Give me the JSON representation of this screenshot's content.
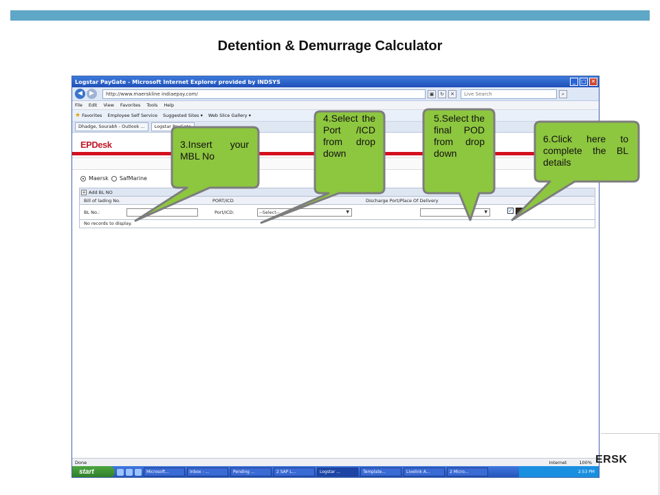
{
  "slide": {
    "title": "Detention & Demurrage Calculator",
    "brand": "ERSK"
  },
  "browser": {
    "title": "Logstar PayGate - Microsoft Internet Explorer provided by INDSYS",
    "address": "http://www.maerskline indiaepay.com/",
    "search_placeholder": "Live Search",
    "menu": [
      "File",
      "Edit",
      "View",
      "Favorites",
      "Tools",
      "Help"
    ],
    "favorites_label": "Favorites",
    "fav_links": [
      "Employee Self Service",
      "Suggested Sites ▾",
      "Web Slice Gallery ▾"
    ],
    "tabs": [
      "Dhadge, Sourabh - Outlook ...",
      "Logstar PayGate"
    ],
    "page_label": "Page ▾",
    "status_left": "Done",
    "zone": "Internet",
    "zoom": "100%"
  },
  "app": {
    "logo": "EPDesk",
    "radio_maersk": "Maersk",
    "radio_safmarine": "SafMarine",
    "add_bl": "Add BL NO",
    "col_bl": "Bill of lading No.",
    "col_port": "PORT/ICD",
    "col_discharge": "Discharge Port/Place Of Delivery",
    "bl_label": "BL No.:",
    "port_label": "Port/ICD:",
    "port_select": "--Select--",
    "pod_select": "",
    "no_records": "No records to display."
  },
  "taskbar": {
    "start": "start",
    "items": [
      "Microsoft...",
      "Inbox - ...",
      "Pending ...",
      "2 SAP L...",
      "Logstar ...",
      "Template...",
      "Livelink A...",
      "2 Micro..."
    ],
    "clock": "2:53 PM"
  },
  "callouts": {
    "c3": "3.Insert your MBL No",
    "c4": "4.Select the Port /ICD from drop down",
    "c5": "5.Select the final POD from drop down",
    "c6": "6.Click here to complete the BL details"
  }
}
